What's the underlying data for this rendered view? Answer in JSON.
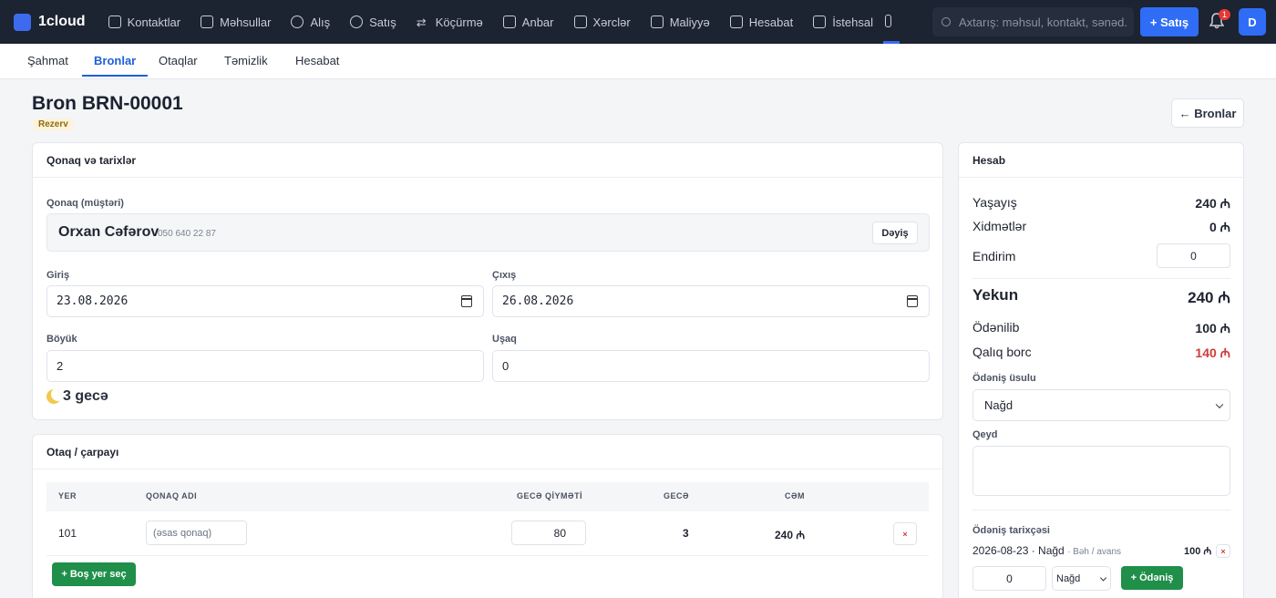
{
  "topnav": {
    "logo": "1cloud",
    "items": [
      "Kontaktlar",
      "Məhsullar",
      "Alış",
      "Satış",
      "Köçürmə",
      "Anbar",
      "Xərclər",
      "Maliyyə",
      "Hesabat",
      "İstehsal"
    ],
    "search_placeholder": "Axtarış: məhsul, kontakt, sənəd...",
    "sale_button": "+ Satış",
    "notification_count": "1",
    "avatar_initial": "D"
  },
  "subnav": {
    "tabs": [
      "Şahmat",
      "Bronlar",
      "Otaqlar",
      "Təmizlik",
      "Hesabat"
    ],
    "active": "Bronlar"
  },
  "page": {
    "title": "Bron BRN-00001",
    "status": "Rezerv",
    "back_button": "← Bronlar"
  },
  "guest_card": {
    "title": "Qonaq və tarixlər",
    "guest_label": "Qonaq (müştəri)",
    "guest_name": "Orxan Cəfərov",
    "guest_phone": "050 640 22 87",
    "change_button": "Dəyiş",
    "checkin_label": "Giriş",
    "checkin_value": "23.08.2026",
    "checkout_label": "Çıxış",
    "checkout_value": "26.08.2026",
    "adults_label": "Böyük",
    "adults_value": "2",
    "children_label": "Uşaq",
    "children_value": "0",
    "nights": "3 gecə"
  },
  "room_card": {
    "title": "Otaq / çarpayı",
    "columns": [
      "YER",
      "QONAQ ADI",
      "GECƏ QİYMƏTİ",
      "GECƏ",
      "CƏM"
    ],
    "row": {
      "place": "101",
      "guest_placeholder": "(əsas qonaq)",
      "price": "80",
      "nights": "3",
      "total": "240 ₼"
    },
    "add_button": "+ Boş yer seç",
    "remove_icon": "×"
  },
  "account_card": {
    "title": "Hesab",
    "living_label": "Yaşayış",
    "living_value": "240 ₼",
    "services_label": "Xidmətlər",
    "services_value": "0 ₼",
    "discount_label": "Endirim",
    "discount_value": "0",
    "total_label": "Yekun",
    "total_value": "240 ₼",
    "paid_label": "Ödənilib",
    "paid_value": "100 ₼",
    "debt_label": "Qalıq borc",
    "debt_value": "140 ₼",
    "method_label": "Ödəniş üsulu",
    "method_value": "Nağd",
    "note_label": "Qeyd",
    "history_label": "Ödəniş tarixçəsi",
    "history_entry": "2026-08-23 · Nağd",
    "history_note": "· Bəh / avans",
    "history_amount": "100 ₼",
    "new_amount": "0",
    "new_method": "Nağd",
    "payment_button": "+ Ödəniş"
  },
  "colors": {
    "topbar": "#1c2331",
    "accent": "#2f6df6",
    "success": "#1f8f4a",
    "danger": "#d23b3b"
  }
}
